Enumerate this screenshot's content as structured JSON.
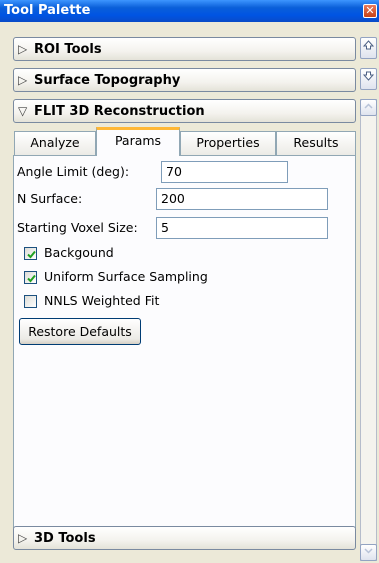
{
  "window": {
    "title": "Tool Palette",
    "close_glyph": "✕"
  },
  "sections": {
    "roi": {
      "label": "ROI Tools",
      "state": "collapsed"
    },
    "surface": {
      "label": "Surface Topography",
      "state": "collapsed"
    },
    "flit": {
      "label": "FLIT 3D Reconstruction",
      "state": "expanded"
    },
    "tools3d": {
      "label": "3D Tools",
      "state": "collapsed"
    }
  },
  "glyphs": {
    "collapsed": "▷",
    "expanded": "▽"
  },
  "tabs": [
    {
      "label": "Analyze",
      "active": false
    },
    {
      "label": "Params",
      "active": true
    },
    {
      "label": "Properties",
      "active": false
    },
    {
      "label": "Results",
      "active": false
    }
  ],
  "params": {
    "angle_limit": {
      "label": "Angle Limit (deg):",
      "value": "70"
    },
    "n_surface": {
      "label": "N Surface:",
      "value": "200"
    },
    "voxel_size": {
      "label": "Starting Voxel Size:",
      "value": "5"
    }
  },
  "options": [
    {
      "label": "Backgound",
      "checked": true
    },
    {
      "label": "Uniform Surface Sampling",
      "checked": true
    },
    {
      "label": "NNLS Weighted Fit",
      "checked": false
    }
  ],
  "restore_label": "Restore Defaults",
  "colors": {
    "title_bar": "#0054e3",
    "active_tab_accent": "#ffb735",
    "check": "#21a121"
  }
}
